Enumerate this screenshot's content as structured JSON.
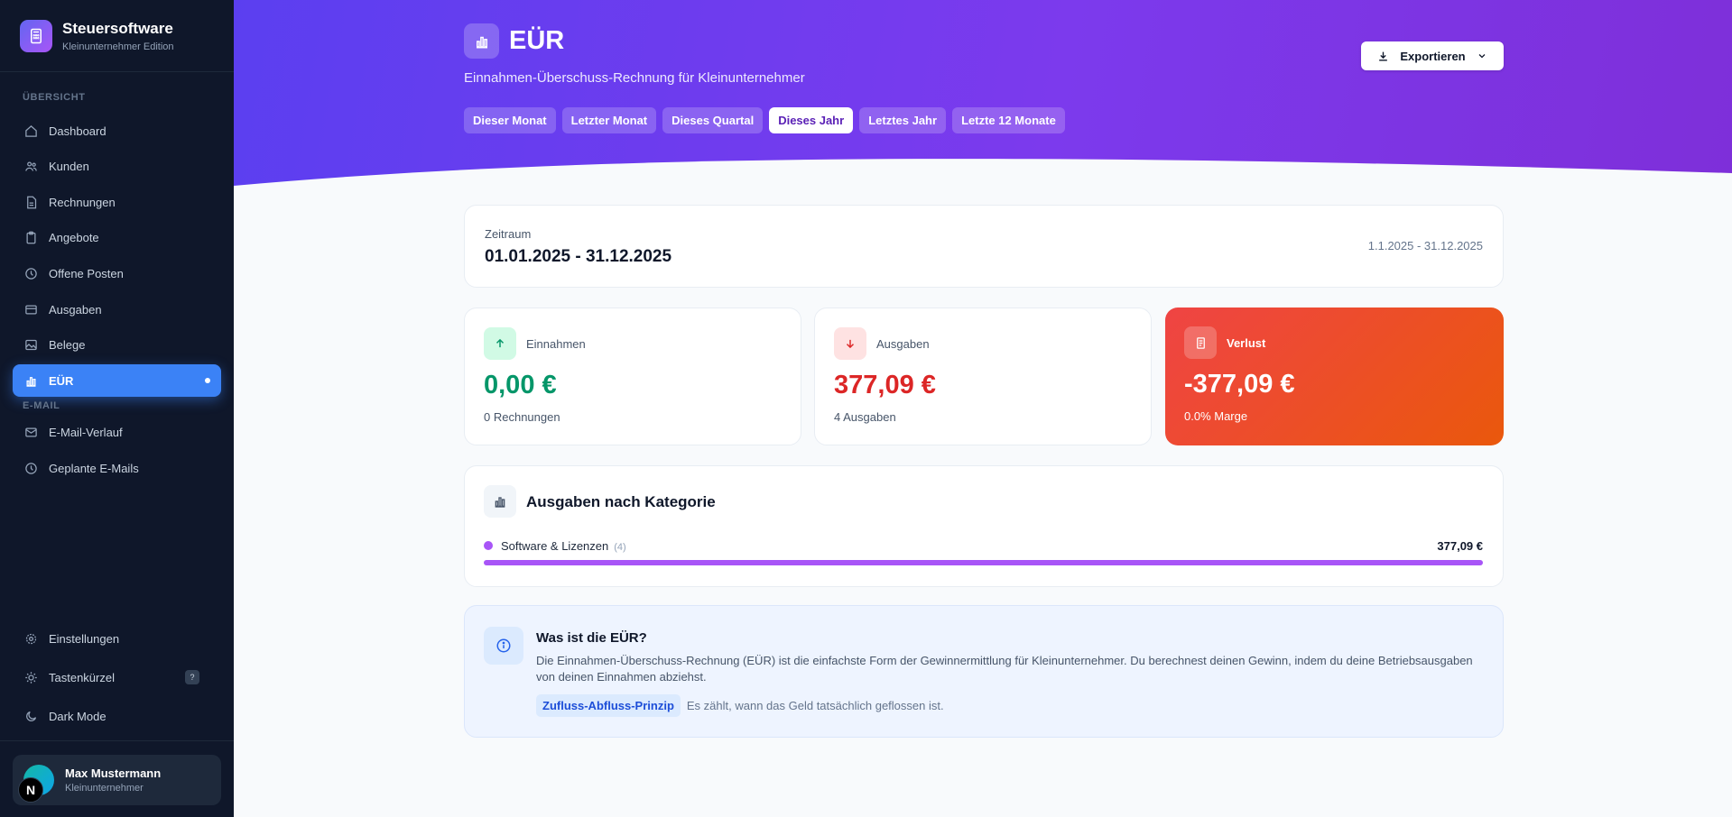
{
  "app": {
    "name": "Steuersoftware",
    "edition": "Kleinunternehmer Edition"
  },
  "sidebar": {
    "section_overview": "ÜBERSICHT",
    "section_email": "E-MAIL",
    "items": [
      {
        "label": "Dashboard",
        "icon": "home-icon"
      },
      {
        "label": "Kunden",
        "icon": "users-icon"
      },
      {
        "label": "Rechnungen",
        "icon": "file-icon"
      },
      {
        "label": "Angebote",
        "icon": "clipboard-icon"
      },
      {
        "label": "Offene Posten",
        "icon": "clock-icon"
      },
      {
        "label": "Ausgaben",
        "icon": "credit-card-icon"
      },
      {
        "label": "Belege",
        "icon": "image-icon"
      },
      {
        "label": "EÜR",
        "icon": "bar-chart-icon",
        "active": true
      }
    ],
    "email_items": [
      {
        "label": "E-Mail-Verlauf",
        "icon": "mail-icon"
      },
      {
        "label": "Geplante E-Mails",
        "icon": "clock-icon"
      }
    ],
    "bottom_items": [
      {
        "label": "Einstellungen",
        "icon": "gear-icon"
      },
      {
        "label": "Tastenkürzel",
        "icon": "sun-icon",
        "shortcut": "?"
      },
      {
        "label": "Dark Mode",
        "icon": "moon-icon"
      }
    ],
    "user": {
      "name": "Max Mustermann",
      "role": "Kleinunternehmer",
      "avatar_badge": "N"
    }
  },
  "header": {
    "title": "EÜR",
    "subtitle": "Einnahmen-Überschuss-Rechnung für Kleinunternehmer",
    "export_label": "Exportieren",
    "tabs": [
      {
        "label": "Dieser Monat",
        "active": false
      },
      {
        "label": "Letzter Monat",
        "active": false
      },
      {
        "label": "Dieses Quartal",
        "active": false
      },
      {
        "label": "Dieses Jahr",
        "active": true
      },
      {
        "label": "Letztes Jahr",
        "active": false
      },
      {
        "label": "Letzte 12 Monate",
        "active": false
      }
    ]
  },
  "period": {
    "label": "Zeitraum",
    "value": "01.01.2025 - 31.12.2025",
    "short": "1.1.2025 - 31.12.2025"
  },
  "stats": {
    "income": {
      "label": "Einnahmen",
      "value": "0,00 €",
      "sub": "0 Rechnungen",
      "color": "#059669"
    },
    "expenses": {
      "label": "Ausgaben",
      "value": "377,09 €",
      "sub": "4 Ausgaben",
      "color": "#dc2626"
    },
    "result": {
      "label": "Verlust",
      "value": "-377,09 €",
      "sub": "0.0% Marge",
      "color": "#ffffff"
    }
  },
  "categories": {
    "title": "Ausgaben nach Kategorie",
    "items": [
      {
        "name": "Software & Lizenzen",
        "count": "(4)",
        "amount": "377,09 €",
        "share": 1.0,
        "color": "#a855f7"
      }
    ]
  },
  "info": {
    "title": "Was ist die EÜR?",
    "text": "Die Einnahmen-Überschuss-Rechnung (EÜR) ist die einfachste Form der Gewinnermittlung für Kleinunternehmer. Du berechnest deinen Gewinn, indem du deine Betriebsausgaben von deinen Einnahmen abziehst.",
    "badge": "Zufluss-Abfluss-Prinzip",
    "note": "Es zählt, wann das Geld tatsächlich geflossen ist."
  }
}
